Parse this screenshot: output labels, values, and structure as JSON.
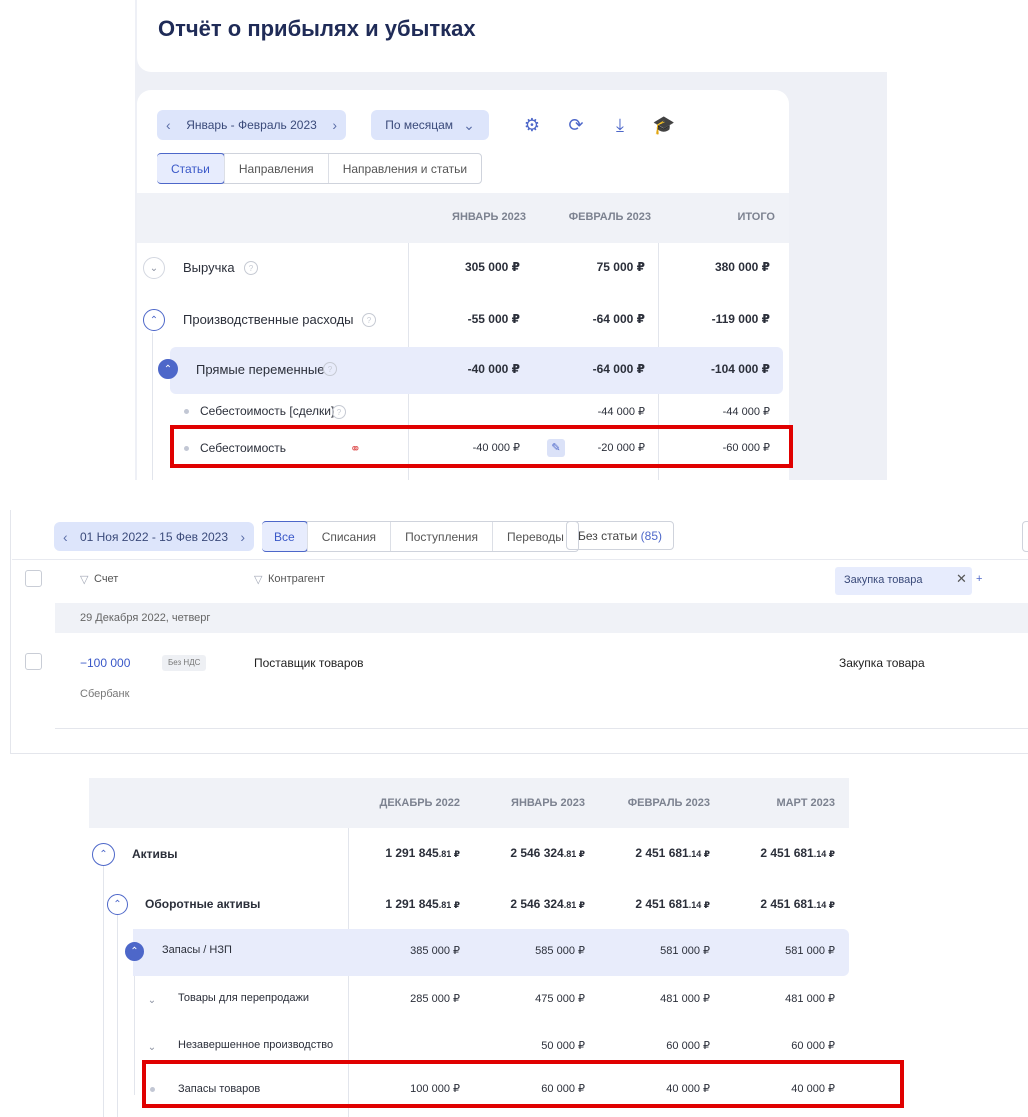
{
  "panel1": {
    "title": "Отчёт о прибылях и убытках",
    "period": "Январь - Февраль 2023",
    "grouping": "По месяцам",
    "tabs": [
      "Статьи",
      "Направления",
      "Направления и статьи"
    ],
    "columns": [
      "ЯНВАРЬ 2023",
      "ФЕВРАЛЬ 2023",
      "ИТОГО"
    ],
    "rows": [
      {
        "name": "Выручка",
        "values": [
          "305 000 ₽",
          "75 000 ₽",
          "380 000 ₽"
        ]
      },
      {
        "name": "Производственные расходы",
        "values": [
          "-55 000 ₽",
          "-64 000 ₽",
          "-119 000 ₽"
        ]
      },
      {
        "name": "Прямые переменные",
        "values": [
          "-40 000 ₽",
          "-64 000 ₽",
          "-104 000 ₽"
        ]
      },
      {
        "name": "Себестоимость [сделки]",
        "values": [
          "",
          "-44 000 ₽",
          "-44 000 ₽"
        ]
      },
      {
        "name": "Себестоимость",
        "values": [
          "-40 000 ₽",
          "-20 000 ₽",
          "-60 000 ₽"
        ]
      }
    ]
  },
  "panel2": {
    "period": "01 Ноя 2022 - 15 Фев 2023",
    "filters": [
      "Все",
      "Списания",
      "Поступления",
      "Переводы"
    ],
    "no_category_label": "Без статьи",
    "no_category_count": "(85)",
    "col_account": "Счет",
    "col_counterparty": "Контрагент",
    "category_tag": "Закупка товара",
    "date_group": "29 Декабря 2022, четверг",
    "operation": {
      "amount": "−100 000",
      "vat": "Без НДС",
      "counterparty": "Поставщик товаров",
      "category": "Закупка товара",
      "account": "Сбербанк"
    }
  },
  "panel3": {
    "columns": [
      "ДЕКАБРЬ 2022",
      "ЯНВАРЬ 2023",
      "ФЕВРАЛЬ 2023",
      "МАРТ 2023"
    ],
    "rows": [
      {
        "name": "Активы",
        "values": [
          [
            "1 291 845",
            ".81 ₽"
          ],
          [
            "2 546 324",
            ".81 ₽"
          ],
          [
            "2 451 681",
            ".14 ₽"
          ],
          [
            "2 451 681",
            ".14 ₽"
          ]
        ]
      },
      {
        "name": "Оборотные активы",
        "values": [
          [
            "1 291 845",
            ".81 ₽"
          ],
          [
            "2 546 324",
            ".81 ₽"
          ],
          [
            "2 451 681",
            ".14 ₽"
          ],
          [
            "2 451 681",
            ".14 ₽"
          ]
        ]
      },
      {
        "name": "Запасы / НЗП",
        "values": [
          "385 000 ₽",
          "585 000 ₽",
          "581 000 ₽",
          "581 000 ₽"
        ]
      },
      {
        "name": "Товары для перепродажи",
        "values": [
          "285 000 ₽",
          "475 000 ₽",
          "481 000 ₽",
          "481 000 ₽"
        ]
      },
      {
        "name": "Незавершенное производство",
        "values": [
          "",
          "50 000 ₽",
          "60 000 ₽",
          "60 000 ₽"
        ]
      },
      {
        "name": "Запасы товаров",
        "values": [
          "100 000 ₽",
          "60 000 ₽",
          "40 000 ₽",
          "40 000 ₽"
        ]
      }
    ]
  },
  "colors": {
    "accent": "#4d67c9",
    "highlight": "#e00000",
    "pill": "#dde5fb"
  }
}
